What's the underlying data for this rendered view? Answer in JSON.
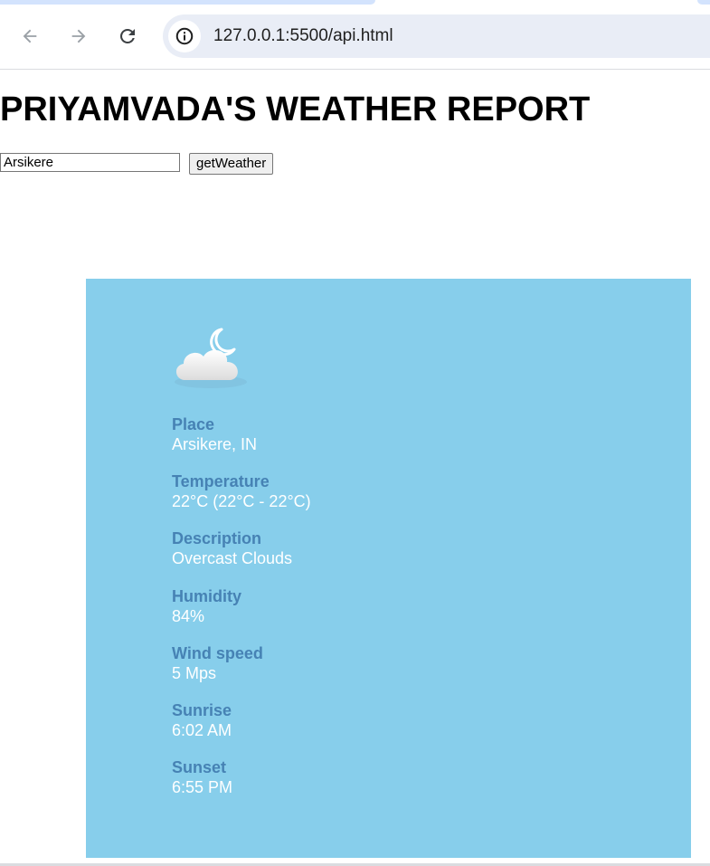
{
  "browser": {
    "url": "127.0.0.1:5500/api.html",
    "icons": {
      "back": "arrow-left-icon",
      "forward": "arrow-right-icon",
      "reload": "reload-icon",
      "site_info": "info-icon"
    }
  },
  "page": {
    "title": "PRIYAMVADA'S WEATHER REPORT",
    "search": {
      "value": "Arsikere",
      "button_label": "getWeather"
    }
  },
  "weather": {
    "icon": "night-cloud-icon",
    "fields": [
      {
        "label": "Place",
        "value": "Arsikere, IN"
      },
      {
        "label": "Temperature",
        "value": "22°C (22°C - 22°C)"
      },
      {
        "label": "Description",
        "value": "Overcast Clouds"
      },
      {
        "label": "Humidity",
        "value": "84%"
      },
      {
        "label": "Wind speed",
        "value": "5 Mps"
      },
      {
        "label": "Sunrise",
        "value": "6:02 AM"
      },
      {
        "label": "Sunset",
        "value": "6:55 PM"
      }
    ]
  },
  "colors": {
    "card_background": "#87ceeb",
    "label": "#4682b4",
    "value": "#ffffff"
  }
}
